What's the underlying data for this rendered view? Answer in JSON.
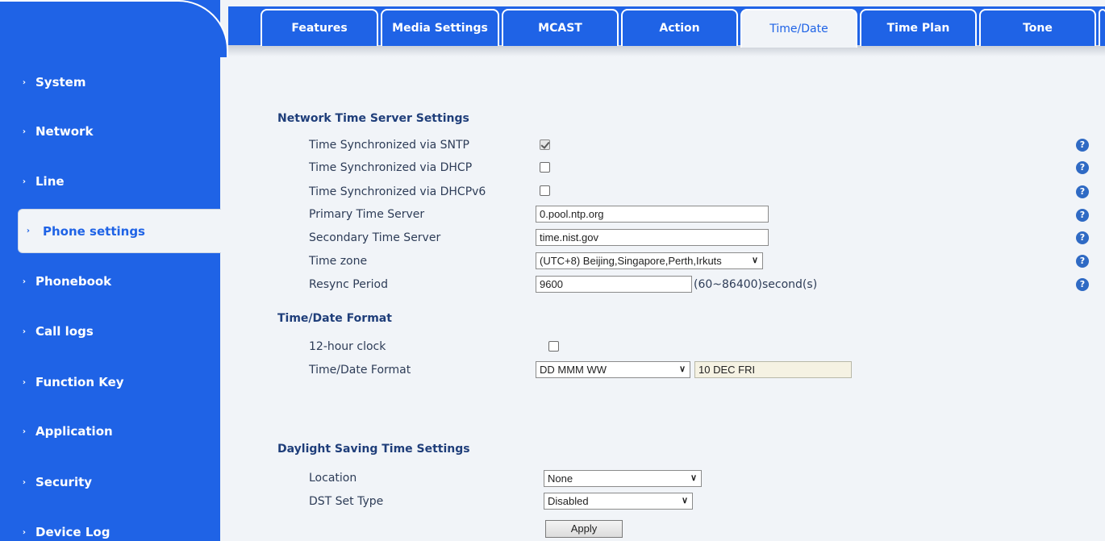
{
  "sidebar": {
    "items": [
      {
        "label": "System"
      },
      {
        "label": "Network"
      },
      {
        "label": "Line"
      },
      {
        "label": "Phone settings"
      },
      {
        "label": "Phonebook"
      },
      {
        "label": "Call logs"
      },
      {
        "label": "Function Key"
      },
      {
        "label": "Application"
      },
      {
        "label": "Security"
      },
      {
        "label": "Device Log"
      }
    ],
    "arrow": "›"
  },
  "tabs": [
    {
      "label": "Features"
    },
    {
      "label": "Media Settings"
    },
    {
      "label": "MCAST"
    },
    {
      "label": "Action"
    },
    {
      "label": "Time/Date"
    },
    {
      "label": "Time Plan"
    },
    {
      "label": "Tone"
    }
  ],
  "network_time": {
    "title": "Network Time Server Settings",
    "sntp_label": "Time Synchronized via SNTP",
    "dhcp_label": "Time Synchronized via DHCP",
    "dhcpv6_label": "Time Synchronized via DHCPv6",
    "primary_label": "Primary Time Server",
    "primary_value": "0.pool.ntp.org",
    "secondary_label": "Secondary Time Server",
    "secondary_value": "time.nist.gov",
    "timezone_label": "Time zone",
    "timezone_value": "(UTC+8) Beijing,Singapore,Perth,Irkuts",
    "resync_label": "Resync Period",
    "resync_value": "9600",
    "resync_suffix": "(60~86400)second(s)"
  },
  "format": {
    "title": "Time/Date Format",
    "clock_label": "12-hour clock",
    "format_label": "Time/Date Format",
    "format_value": "DD MMM WW",
    "preview_value": "10 DEC FRI"
  },
  "dst": {
    "title": "Daylight Saving Time Settings",
    "location_label": "Location",
    "location_value": "None",
    "type_label": "DST Set Type",
    "type_value": "Disabled",
    "apply_label": "Apply"
  },
  "icons": {
    "help": "?",
    "chevron": "∨"
  },
  "colors": {
    "accent": "#1f63e6",
    "background": "#f1f4f8",
    "help": "#2f6ac4"
  }
}
